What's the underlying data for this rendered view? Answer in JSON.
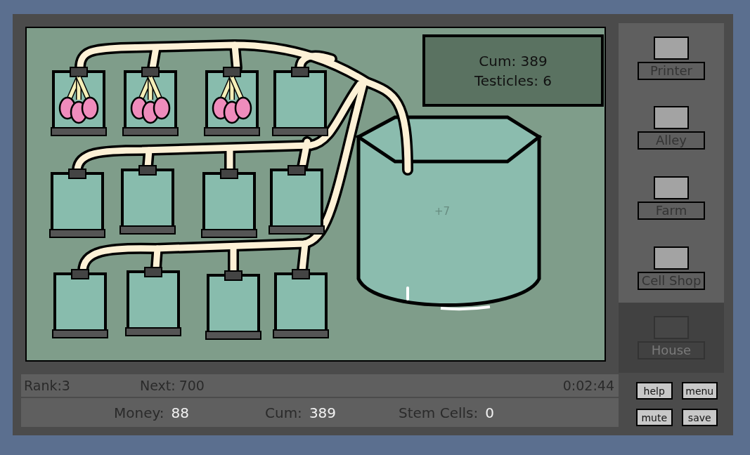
{
  "stats": {
    "lines": [
      "Cum: 389",
      "Testicles: 6"
    ]
  },
  "vessel": {
    "gain": "+7"
  },
  "tanks": [
    {
      "filled": true
    },
    {
      "filled": true
    },
    {
      "filled": true
    },
    {
      "filled": false
    },
    {
      "filled": false
    },
    {
      "filled": false
    },
    {
      "filled": false
    },
    {
      "filled": false
    },
    {
      "filled": false
    },
    {
      "filled": false
    },
    {
      "filled": false
    },
    {
      "filled": false
    }
  ],
  "sidebar": {
    "items": [
      {
        "label": "Printer",
        "disabled": false
      },
      {
        "label": "Alley",
        "disabled": false
      },
      {
        "label": "Farm",
        "disabled": false
      },
      {
        "label": "Cell Shop",
        "disabled": false
      },
      {
        "label": "House",
        "disabled": true
      }
    ]
  },
  "status_bar": {
    "rank": "Rank:3",
    "next_label": "Next:",
    "next": "700",
    "timer": "0:02:44"
  },
  "resources": [
    {
      "label": "Money:",
      "value": "88"
    },
    {
      "label": "Cum:",
      "value": "389"
    },
    {
      "label": "Stem Cells:",
      "value": "0"
    }
  ],
  "buttons": [
    "help",
    "menu",
    "mute",
    "save"
  ]
}
